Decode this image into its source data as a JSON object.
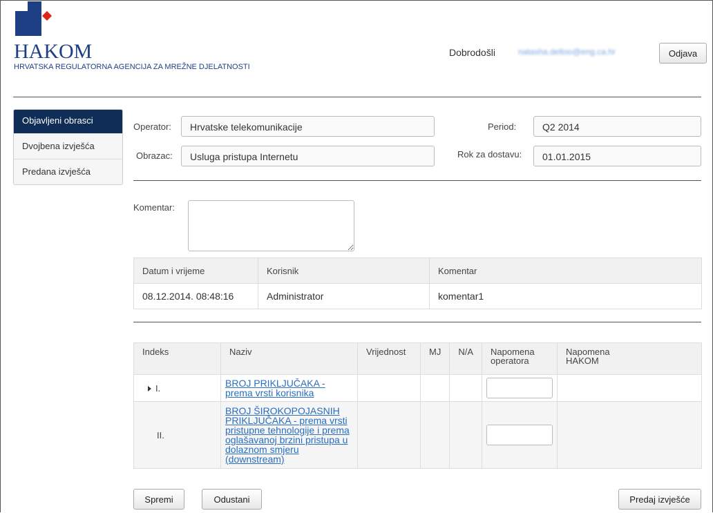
{
  "header": {
    "logo_text": "HAKOM",
    "logo_subtitle": "HRVATSKA REGULATORNA AGENCIJA ZA MREŽNE DJELATNOSTI",
    "welcome": "Dobrodošli",
    "user_email": "natasha.deltoo@eng.ca.hr",
    "logout_label": "Odjava"
  },
  "sidebar": {
    "items": [
      {
        "label": "Objavljeni obrasci",
        "active": true
      },
      {
        "label": "Dvojbena izvješća",
        "active": false
      },
      {
        "label": "Predana izvješća",
        "active": false
      }
    ]
  },
  "form": {
    "operator_label": "Operator:",
    "operator_value": "Hrvatske telekomunikacije",
    "period_label": "Period:",
    "period_value": "Q2 2014",
    "obrazac_label": "Obrazac:",
    "obrazac_value": "Usluga pristupa Internetu",
    "rok_label": "Rok za dostavu:",
    "rok_value": "01.01.2015",
    "komentar_label": "Komentar:"
  },
  "history_table": {
    "headers": [
      "Datum i vrijeme",
      "Korisnik",
      "Komentar"
    ],
    "rows": [
      [
        "08.12.2014. 08:48:16",
        "Administrator",
        "komentar1"
      ]
    ]
  },
  "data_table": {
    "headers": {
      "indeks": "Indeks",
      "naziv": "Naziv",
      "vrijednost": "Vrijednost",
      "mj": "MJ",
      "na": "N/A",
      "nap_op_1": "Napomena",
      "nap_op_2": "operatora",
      "nap_hak_1": "Napomena",
      "nap_hak_2": "HAKOM"
    },
    "rows": [
      {
        "index": "I.",
        "name_lines": [
          "BROJ PRIKLJUČAKA -",
          "prema vrsti korisnika"
        ]
      },
      {
        "index": "II.",
        "name_lines": [
          "BROJ ŠIROKOPOJASNIH",
          "PRIKLJUČAKA - prema vrsti",
          "pristupne tehnologije i prema",
          "oglašavanoj brzini pristupa u",
          "dolaznom smjeru",
          "(downstream)"
        ]
      }
    ]
  },
  "footer": {
    "save_label": "Spremi",
    "cancel_label": "Odustani",
    "submit_label": "Predaj izvješće"
  },
  "colors": {
    "logo_blue": "#1f3f84",
    "logo_red": "#e2231a",
    "sidebar_active": "#0f2d56",
    "link": "#2a6ebf"
  }
}
